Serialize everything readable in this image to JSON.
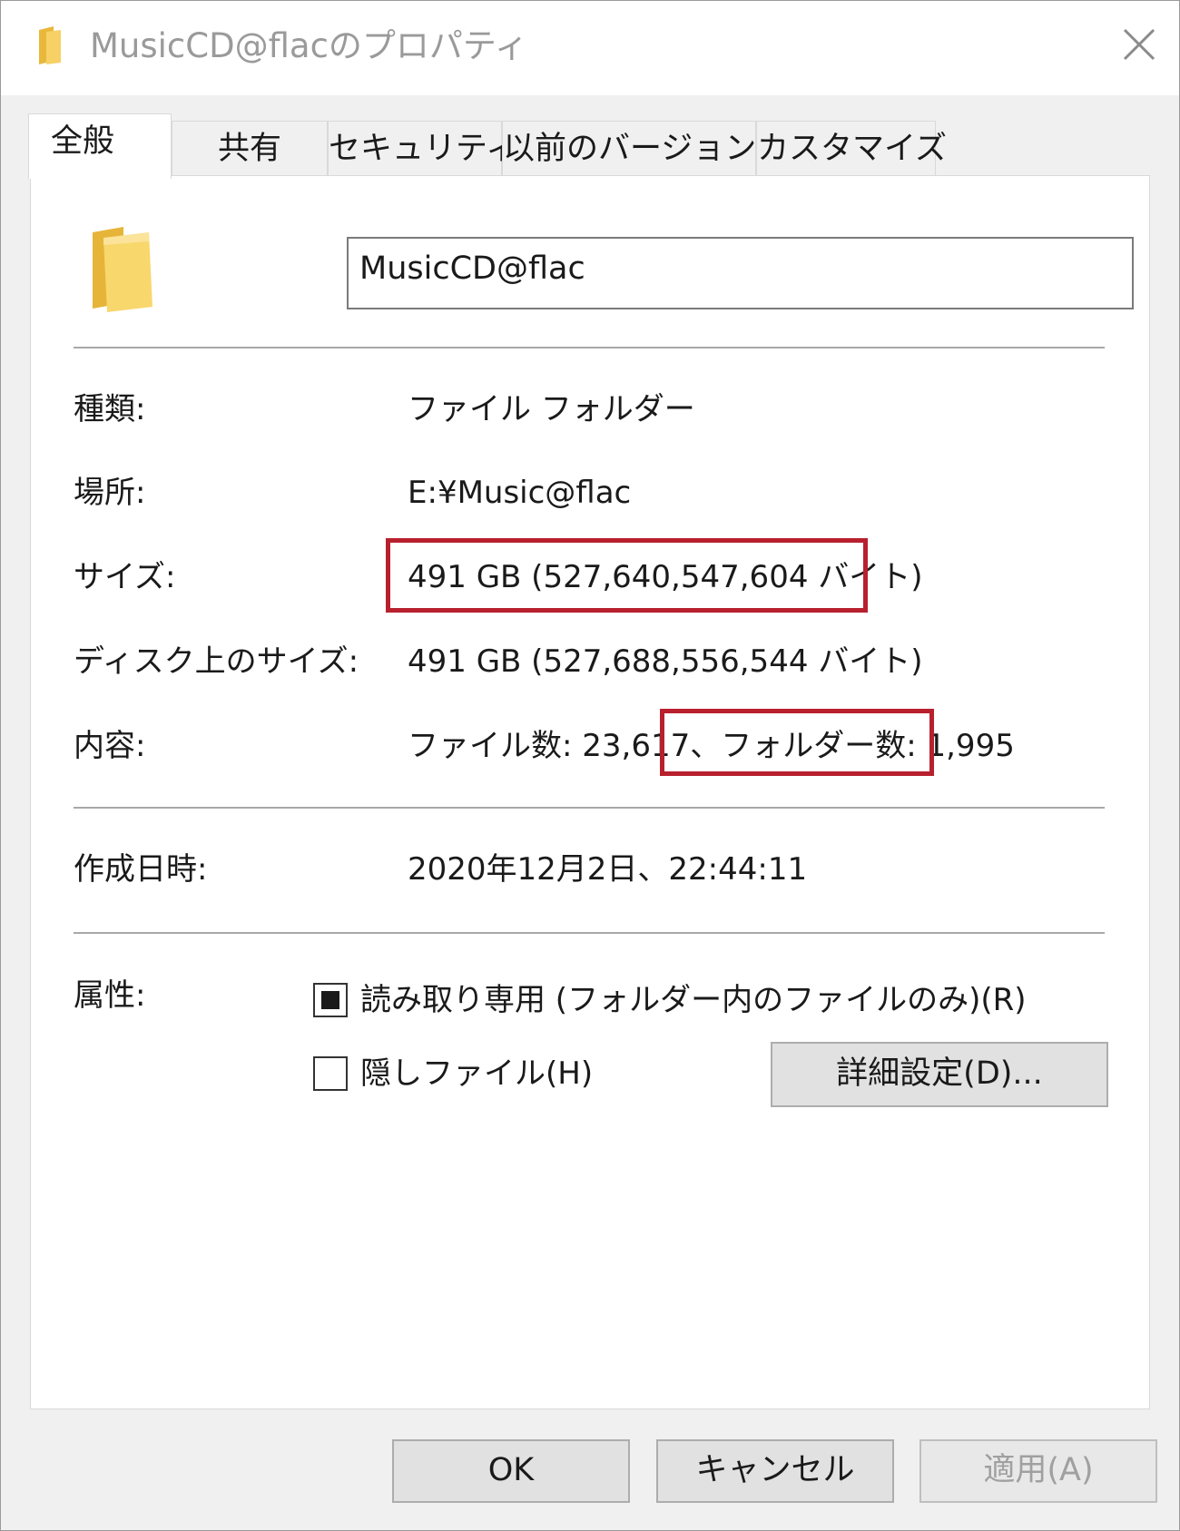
{
  "window": {
    "title": "MusicCD@flacのプロパティ",
    "close_icon": "close-icon",
    "folder_icon": "folder-icon"
  },
  "tabs": [
    {
      "label": "全般",
      "active": true
    },
    {
      "label": "共有",
      "active": false
    },
    {
      "label": "セキュリティ",
      "active": false
    },
    {
      "label": "以前のバージョン",
      "active": false
    },
    {
      "label": "カスタマイズ",
      "active": false
    }
  ],
  "general": {
    "folder_name": "MusicCD@flac",
    "type_label": "種類:",
    "type_value": "ファイル フォルダー",
    "location_label": "場所:",
    "location_value": "E:¥Music@flac",
    "size_label": "サイズ:",
    "size_value": "491 GB (527,640,547,604 バイト)",
    "disk_size_label": "ディスク上のサイズ:",
    "disk_size_value": "491 GB (527,688,556,544 バイト)",
    "contents_label": "内容:",
    "contents_files": "ファイル数: 23,617、",
    "contents_folders": "フォルダー数: 1,995",
    "created_label": "作成日時:",
    "created_value": "2020年12月2日、22:44:11",
    "attributes_label": "属性:",
    "readonly_label": "読み取り専用 (フォルダー内のファイルのみ)(R)",
    "readonly_state": "indeterminate",
    "hidden_label": "隠しファイル(H)",
    "hidden_checked": false,
    "advanced_button": "詳細設定(D)..."
  },
  "footer": {
    "ok": "OK",
    "cancel": "キャンセル",
    "apply": "適用(A)"
  },
  "colors": {
    "highlight": "#b8202e",
    "folder": "#f5c84c"
  }
}
